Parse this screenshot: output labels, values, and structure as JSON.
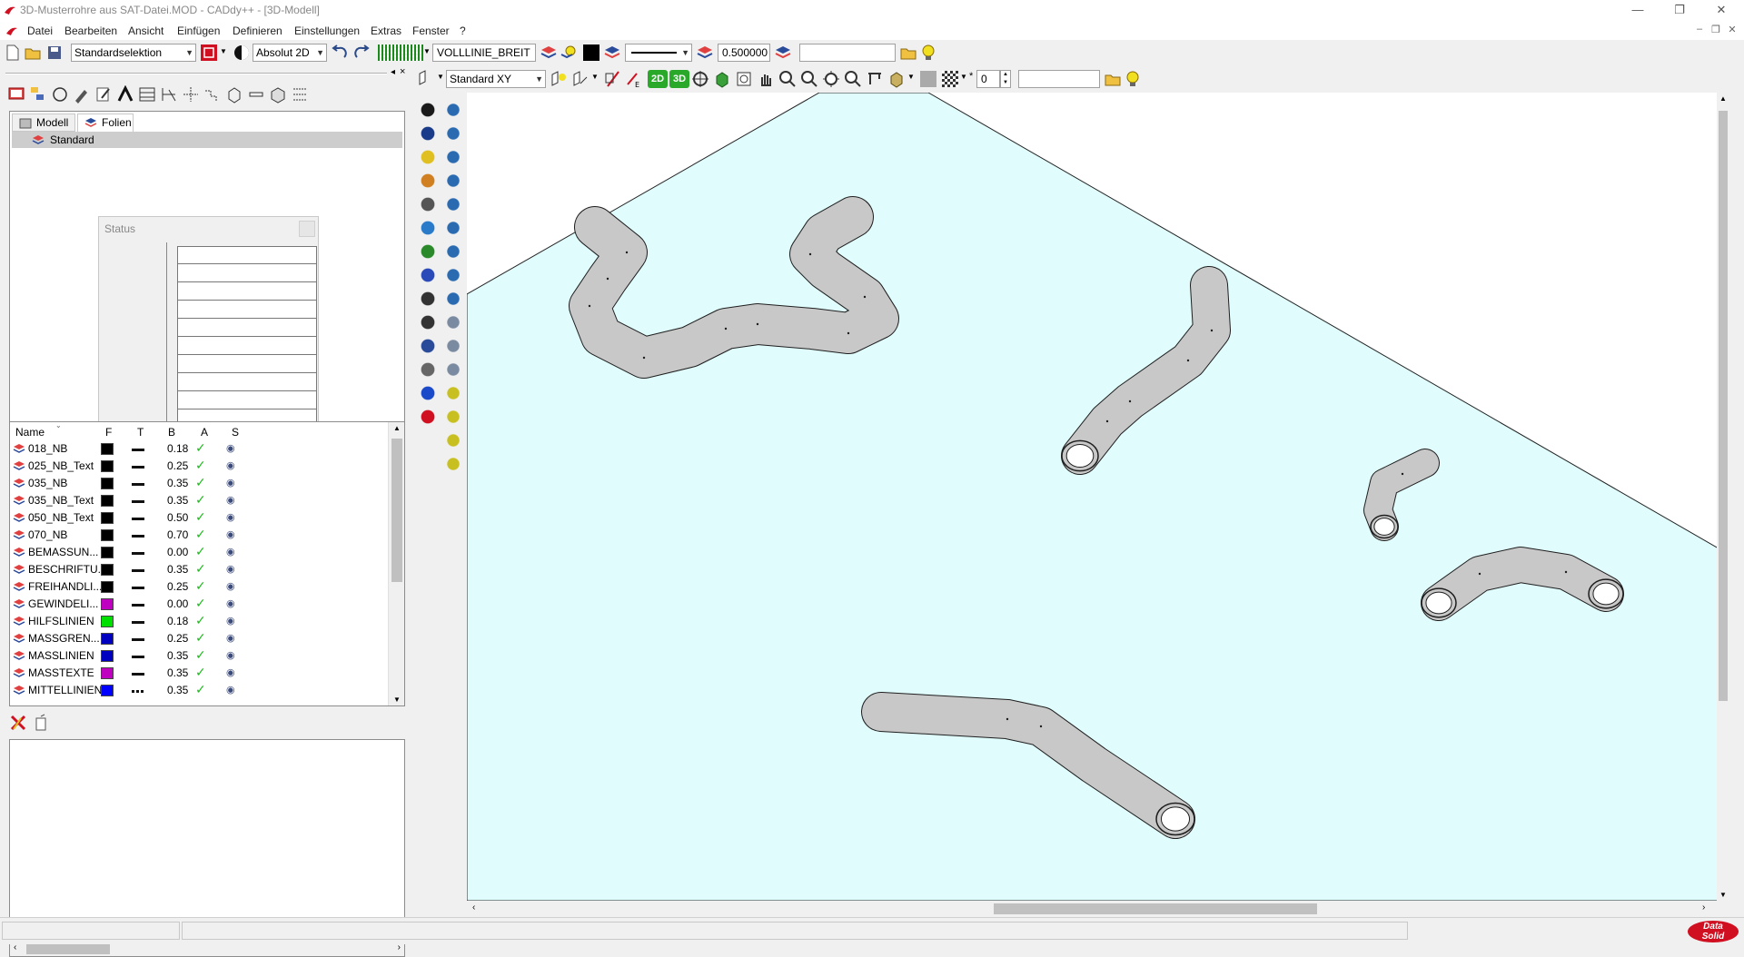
{
  "window": {
    "title": "3D-Musterrohre aus SAT-Datei.MOD  -  CADdy++ - [3D-Modell]",
    "minimize": "—",
    "restore": "❐",
    "close": "✕"
  },
  "menu": [
    "Datei",
    "Bearbeiten",
    "Ansicht",
    "Einfügen",
    "Definieren",
    "Einstellungen",
    "Extras",
    "Fenster",
    "?"
  ],
  "mdi_controls": [
    "–",
    "❐",
    "✕"
  ],
  "toolbar1": {
    "selection_mode": "Standardselektion",
    "coordinate_mode": "Absolut 2D",
    "linetype": "VOLLLINIE_BREIT",
    "line_width": "0.500000",
    "search_value": ""
  },
  "toolbar2": {
    "view": "Standard XY",
    "btn_2d": "2D",
    "btn_3d": "3D",
    "spin_value": "0",
    "search_value": ""
  },
  "left_panel": {
    "tabs": [
      "Modell",
      "Folien"
    ],
    "active_tab": "Folien",
    "tree_root": "Standard",
    "status_dialog_title": "Status",
    "layer_columns": [
      "Name",
      "F",
      "T",
      "B",
      "A",
      "S"
    ],
    "layers": [
      {
        "name": "018_NB",
        "color": "#000000",
        "width": "0.18",
        "dashed": false
      },
      {
        "name": "025_NB_Text",
        "color": "#000000",
        "width": "0.25",
        "dashed": false
      },
      {
        "name": "035_NB",
        "color": "#000000",
        "width": "0.35",
        "dashed": false
      },
      {
        "name": "035_NB_Text",
        "color": "#000000",
        "width": "0.35",
        "dashed": false
      },
      {
        "name": "050_NB_Text",
        "color": "#000000",
        "width": "0.50",
        "dashed": false
      },
      {
        "name": "070_NB",
        "color": "#000000",
        "width": "0.70",
        "dashed": false
      },
      {
        "name": "BEMASSUN...",
        "color": "#000000",
        "width": "0.00",
        "dashed": false
      },
      {
        "name": "BESCHRIFTU...",
        "color": "#000000",
        "width": "0.35",
        "dashed": false
      },
      {
        "name": "FREIHANDLI...",
        "color": "#000000",
        "width": "0.25",
        "dashed": false
      },
      {
        "name": "GEWINDELI...",
        "color": "#c000c0",
        "width": "0.00",
        "dashed": false
      },
      {
        "name": "HILFSLINIEN",
        "color": "#00e000",
        "width": "0.18",
        "dashed": false
      },
      {
        "name": "MASSGREN...",
        "color": "#0000c0",
        "width": "0.25",
        "dashed": false
      },
      {
        "name": "MASSLINIEN",
        "color": "#0000c0",
        "width": "0.35",
        "dashed": false
      },
      {
        "name": "MASSTEXTE",
        "color": "#c000c0",
        "width": "0.35",
        "dashed": false
      },
      {
        "name": "MITTELLINIEN",
        "color": "#0000ff",
        "width": "0.35",
        "dashed": true
      }
    ]
  },
  "colors": {
    "viewport_plane": "#e0fcfc",
    "pipe_fill": "#c8c8c8",
    "pipe_edge": "#1e1e1e",
    "brand_red": "#d01020"
  },
  "brand": {
    "line1": "Data",
    "line2": "Solid"
  }
}
